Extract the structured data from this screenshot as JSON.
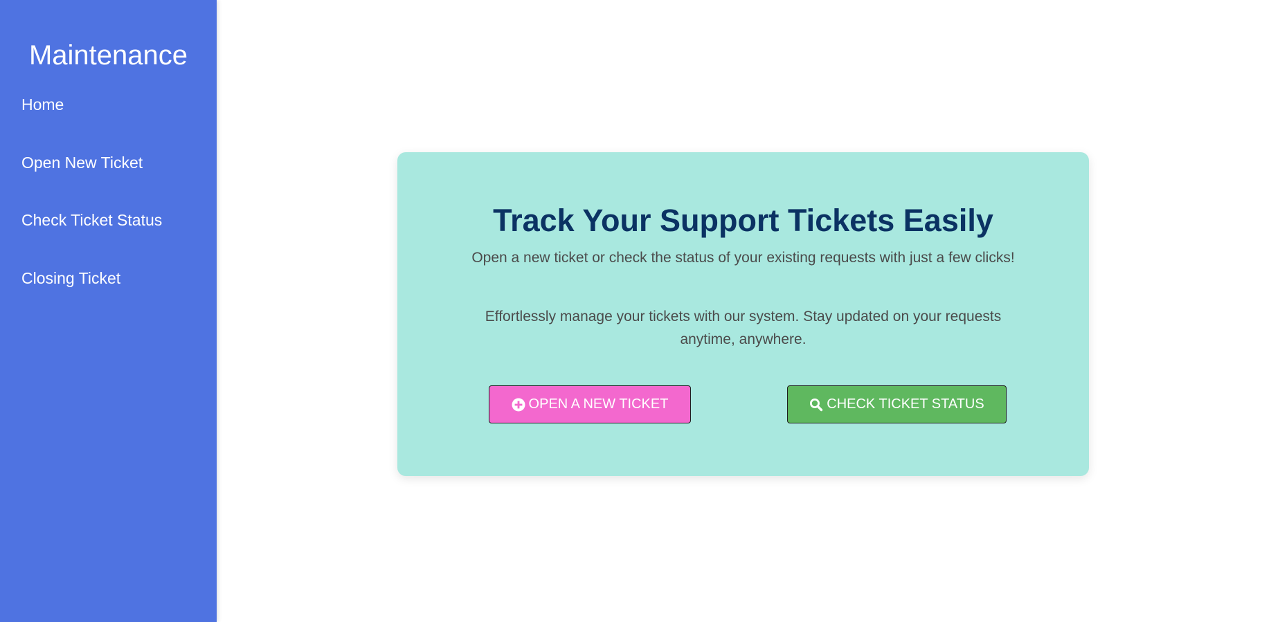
{
  "sidebar": {
    "brand": "Maintenance",
    "items": [
      {
        "label": "Home"
      },
      {
        "label": "Open New Ticket"
      },
      {
        "label": "Check Ticket Status"
      },
      {
        "label": "Closing Ticket"
      }
    ]
  },
  "hero": {
    "title": "Track Your Support Tickets Easily",
    "subtitle": "Open a new ticket or check the status of your existing requests with just a few clicks!",
    "description": "Effortlessly manage your tickets with our system. Stay updated on your requests anytime, anywhere.",
    "buttons": {
      "open_ticket": {
        "label": "OPEN A NEW TICKET",
        "icon": "plus-circle-icon",
        "color": "#f368ce"
      },
      "check_status": {
        "label": "CHECK TICKET STATUS",
        "icon": "search-icon",
        "color": "#5fb85f"
      }
    }
  },
  "colors": {
    "sidebar_bg": "#4f73e1",
    "card_bg": "#a9e8df",
    "title_color": "#0b3263",
    "text_color": "#4b4b4b"
  }
}
